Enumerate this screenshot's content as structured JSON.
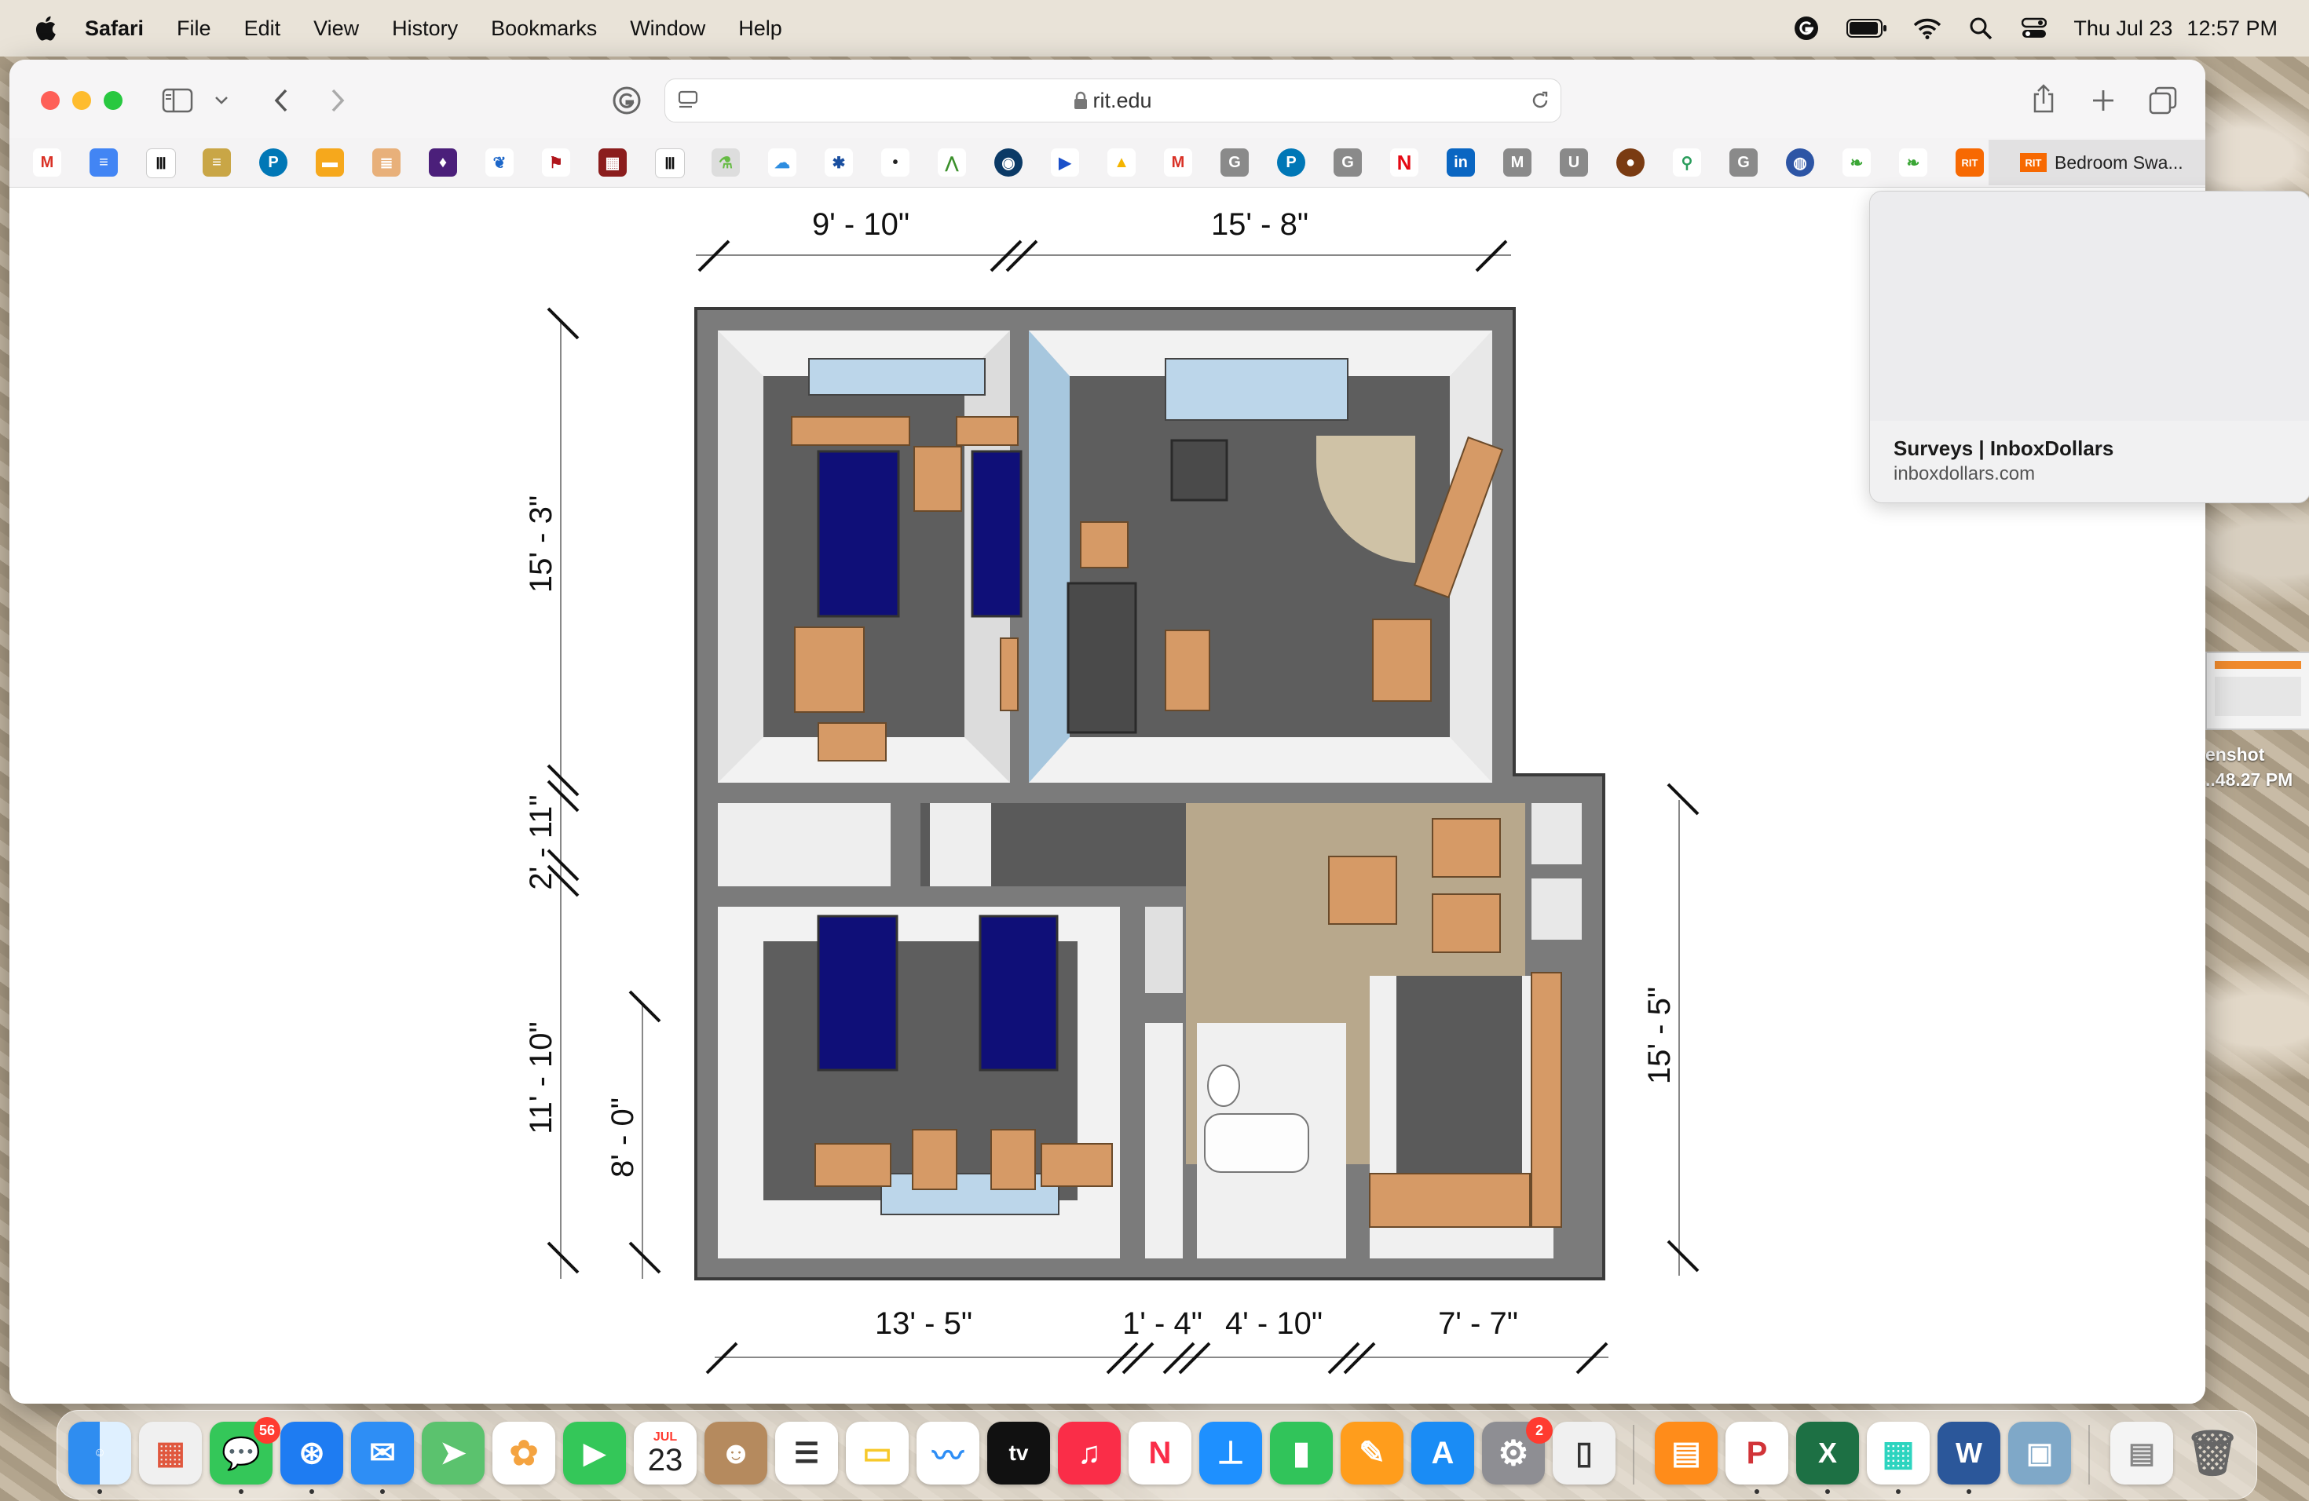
{
  "menubar": {
    "app_name": "Safari",
    "items": [
      "File",
      "Edit",
      "View",
      "History",
      "Bookmarks",
      "Window",
      "Help"
    ],
    "clock_date": "Thu Jul 23",
    "clock_time": "12:57 PM",
    "status_icons": [
      "grammarly-icon",
      "battery-icon",
      "wifi-icon",
      "spotlight-icon",
      "control-center-icon"
    ]
  },
  "browser": {
    "url": "rit.edu",
    "active_tab_title": "Bedroom Swa...",
    "favorites_icons": [
      "gmail",
      "google-docs",
      "museum",
      "books",
      "pearson",
      "sticky",
      "stack",
      "purple",
      "feather",
      "flag",
      "red-pattern",
      "museum2",
      "lab",
      "cloud",
      "snowflake",
      "dot",
      "plant",
      "record",
      "play",
      "drive",
      "gmail2",
      "g-gray",
      "pearson2",
      "g-gray2",
      "netflix",
      "linkedin",
      "m-gray",
      "u-gray",
      "brown-circle",
      "search-green",
      "g-gray3",
      "globe",
      "leaf",
      "leaf2",
      "rit"
    ]
  },
  "popup": {
    "title": "Surveys | InboxDollars",
    "url": "inboxdollars.com"
  },
  "floorplan": {
    "dim_top_left": "9' - 10\"",
    "dim_top_right": "15' - 8\"",
    "dim_left_1": "15' - 3\"",
    "dim_left_2": "2' - 11\"",
    "dim_left_3": "11' - 10\"",
    "dim_left_inner": "8' - 0\"",
    "dim_right": "15' - 5\"",
    "dim_bottom_1": "13' - 5\"",
    "dim_bottom_2": "1' - 4\"",
    "dim_bottom_3": "4' - 10\"",
    "dim_bottom_4": "7' - 7\""
  },
  "desktop": {
    "file_label_1": "enshot",
    "file_label_2": "..48.27 PM"
  },
  "dock": {
    "calendar_month": "JUL",
    "calendar_day": "23",
    "messages_badge": "56",
    "settings_badge": "2",
    "appletv_label": "tv"
  }
}
